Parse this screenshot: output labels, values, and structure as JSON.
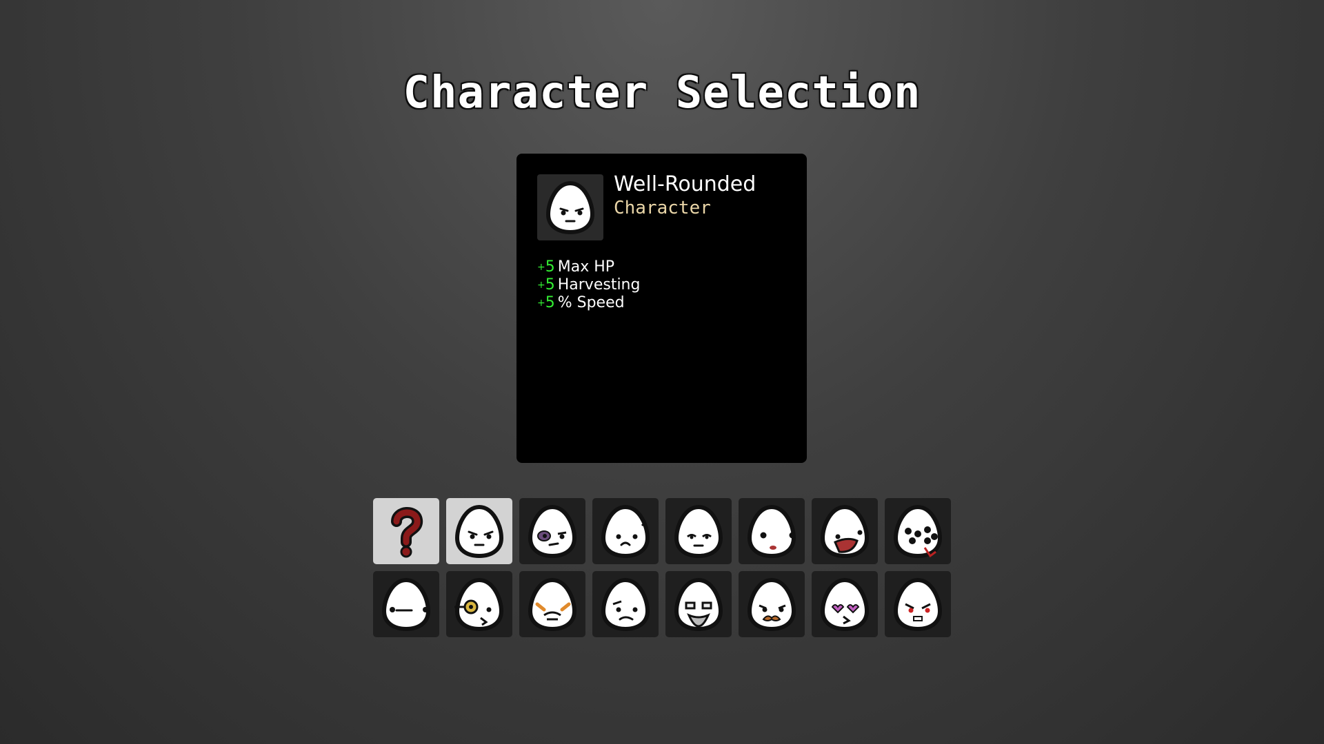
{
  "screen": {
    "title": "Character Selection"
  },
  "selected_character": {
    "name": "Well-Rounded",
    "type": "Character",
    "icon": "grumpy-egg-icon",
    "stats": [
      {
        "value": "5",
        "label": "Max HP"
      },
      {
        "value": "5",
        "label": "Harvesting"
      },
      {
        "value": "5",
        "label": "% Speed"
      }
    ]
  },
  "colors": {
    "stat_positive": "#33ee33",
    "subtitle": "#ead6a8",
    "random_mark": "#8b1a1a",
    "cell_selected_bg": "#d3d3d3",
    "cell_bg": "#1f1f1f"
  },
  "characters": [
    {
      "icon": "random-question-mark-icon",
      "face": "question",
      "highlighted": true
    },
    {
      "icon": "well-rounded-egg-icon",
      "face": "grumpy",
      "highlighted": true
    },
    {
      "icon": "bruised-egg-icon",
      "face": "bruised",
      "highlighted": false
    },
    {
      "icon": "pouting-egg-icon",
      "face": "pout",
      "highlighted": false
    },
    {
      "icon": "squinting-egg-icon",
      "face": "smug",
      "highlighted": false
    },
    {
      "icon": "wide-eyed-egg-icon",
      "face": "wide",
      "highlighted": false
    },
    {
      "icon": "screaming-egg-icon",
      "face": "scream",
      "highlighted": false
    },
    {
      "icon": "multi-eyed-egg-icon",
      "face": "multi",
      "highlighted": false
    },
    {
      "icon": "bored-egg-icon",
      "face": "bored",
      "highlighted": false
    },
    {
      "icon": "monocle-egg-icon",
      "face": "monocle",
      "highlighted": false
    },
    {
      "icon": "angry-brows-egg-icon",
      "face": "brows",
      "highlighted": false
    },
    {
      "icon": "sad-egg-icon",
      "face": "sad",
      "highlighted": false
    },
    {
      "icon": "bearded-egg-icon",
      "face": "beard",
      "highlighted": false
    },
    {
      "icon": "mustache-egg-icon",
      "face": "mustache",
      "highlighted": false
    },
    {
      "icon": "heart-eyes-egg-icon",
      "face": "hearts",
      "highlighted": false
    },
    {
      "icon": "angry-red-eyed-egg-icon",
      "face": "angry",
      "highlighted": false
    }
  ]
}
